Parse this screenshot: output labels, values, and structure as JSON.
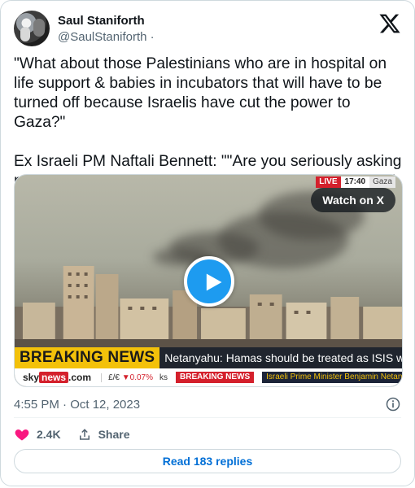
{
  "author": {
    "name": "Saul Staniforth",
    "handle": "@SaulStaniforth",
    "handle_suffix": " ·"
  },
  "tweet": {
    "text": "\"What about those Palestinians who are in hospital on life support & babies in incubators that will have to be turned off because Israelis have cut the power to Gaza?\"\n\nEx Israeli PM Naftali Bennett: \"\"Are you seriously asking me about Palestinian civilians? Whats wrong wth you?\""
  },
  "media": {
    "watch_label": "Watch on X",
    "live_tag": "LIVE",
    "live_time": "17:40",
    "live_location": "Gaza",
    "breaking_label": "BREAKING NEWS",
    "headline": "Netanyahu: Hamas should be treated as ISIS was",
    "sky_prefix": "sky",
    "sky_news": "news",
    "sky_suffix": ".com",
    "fx_pair": "£/€",
    "fx_change": "▼0.07%",
    "fx_trailing": "ks",
    "sub_breaking": "BREAKING NEWS",
    "sub_headline": "Israeli Prime Minister Benjamin Netany"
  },
  "meta": {
    "timestamp": "4:55 PM · Oct 12, 2023"
  },
  "actions": {
    "likes": "2.4K",
    "share": "Share"
  },
  "replies_button": "Read 183 replies",
  "colors": {
    "like": "#f91880",
    "link": "#006fd6",
    "play": "#1d9bf0",
    "breaking": "#f3c10a"
  }
}
